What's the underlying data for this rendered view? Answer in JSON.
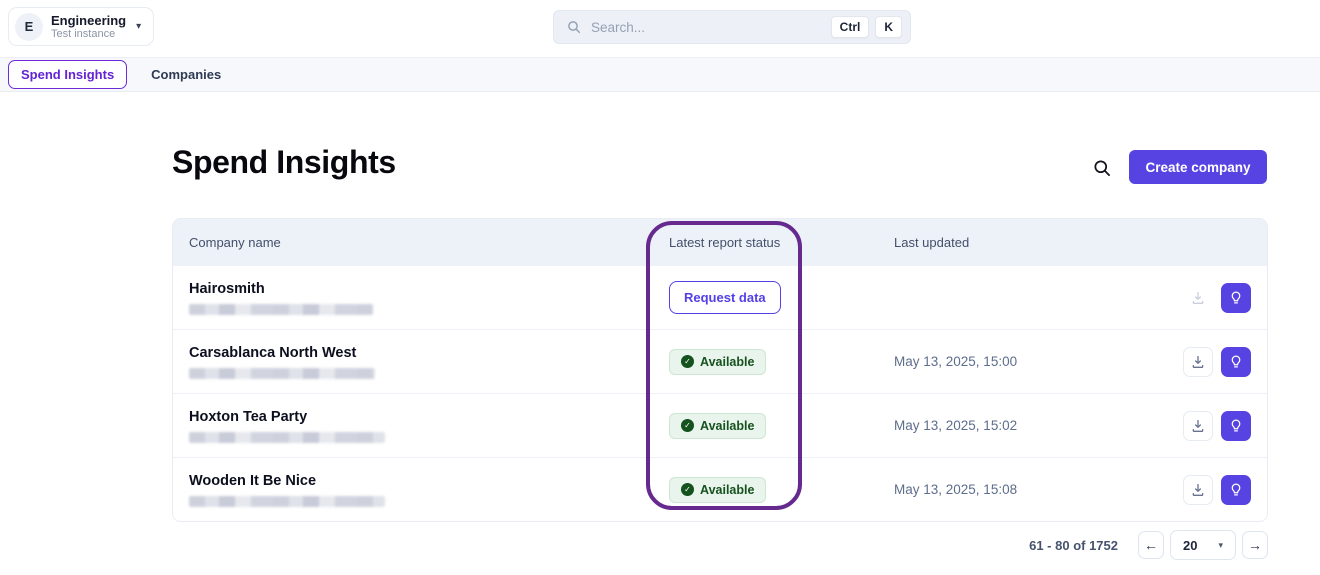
{
  "org": {
    "initial": "E",
    "name": "Engineering",
    "subtitle": "Test instance"
  },
  "search": {
    "placeholder": "Search...",
    "shortcut": {
      "0": "Ctrl",
      "1": "K"
    }
  },
  "nav": {
    "tabs": {
      "0": {
        "label": "Spend Insights"
      },
      "1": {
        "label": "Companies"
      }
    }
  },
  "page": {
    "title": "Spend Insights",
    "create_button_label": "Create company"
  },
  "table": {
    "columns": {
      "0": "Company name",
      "1": "Latest report status",
      "2": "Last updated"
    },
    "rows": {
      "0": {
        "name": "Hairosmith",
        "status": "Request data",
        "status_type": "request",
        "updated": "",
        "download_enabled": false
      },
      "1": {
        "name": "Carsablanca North West",
        "status": "Available",
        "status_type": "available",
        "updated": "May 13, 2025, 15:00",
        "download_enabled": true
      },
      "2": {
        "name": "Hoxton Tea Party",
        "status": "Available",
        "status_type": "available",
        "updated": "May 13, 2025, 15:02",
        "download_enabled": true
      },
      "3": {
        "name": "Wooden It Be Nice",
        "status": "Available",
        "status_type": "available",
        "updated": "May 13, 2025, 15:08",
        "download_enabled": true
      }
    }
  },
  "pagination": {
    "range_text": "61 - 80 of 1752",
    "page_size": "20"
  },
  "icons": {
    "caret_down": "▾",
    "arrow_left": "←",
    "arrow_right": "→",
    "check": "✓"
  },
  "colors": {
    "accent_purple": "#5643e2",
    "annotation_purple": "#662a8f",
    "available_green": "#16521f",
    "header_bg": "#edf1f8"
  }
}
